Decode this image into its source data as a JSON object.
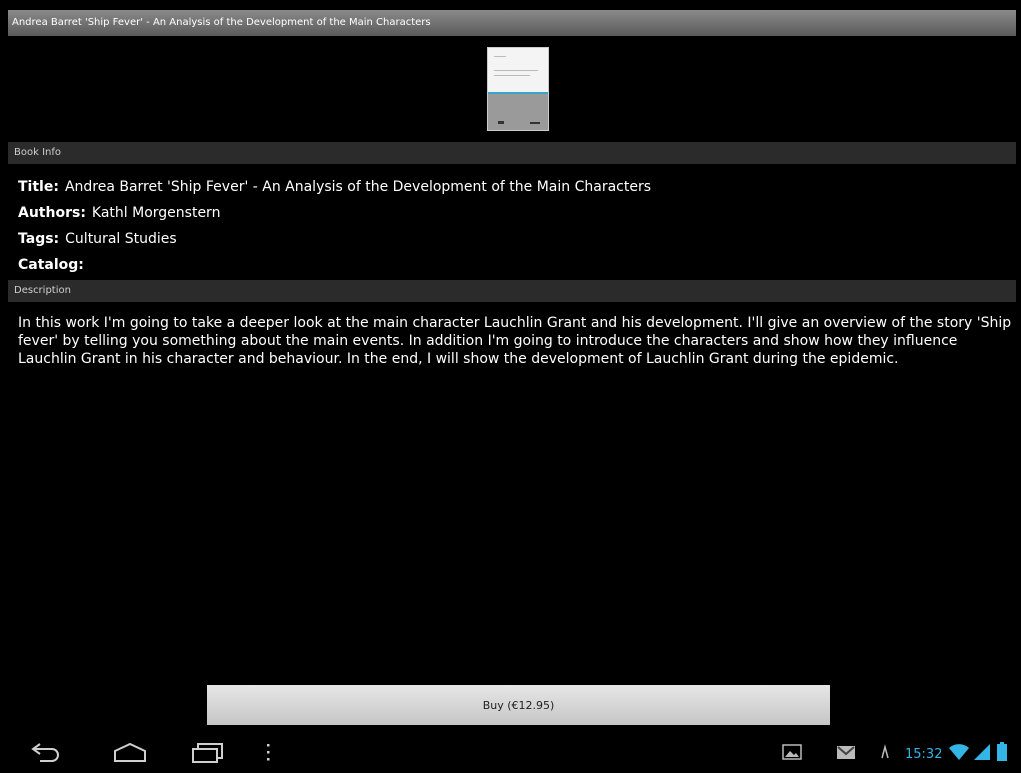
{
  "window": {
    "title": "Andrea Barret 'Ship Fever' - An Analysis of the Development of the Main Characters"
  },
  "book_info": {
    "header": "Book Info",
    "fields": [
      {
        "key": "Title:",
        "value": "Andrea Barret 'Ship Fever' - An Analysis of the Development of the Main Characters"
      },
      {
        "key": "Authors:",
        "value": "Kathl Morgenstern"
      },
      {
        "key": "Tags:",
        "value": "Cultural Studies"
      },
      {
        "key": "Catalog:",
        "value": ""
      }
    ]
  },
  "description": {
    "header": "Description",
    "text": "In this work I'm going to take a deeper look at the main character Lauchlin Grant and his development. I'll give an overview of the story 'Ship fever' by telling you something about the main events. In addition I'm going to introduce the characters and show how they influence Lauchlin Grant in his character and behaviour. In the end, I will show the development of Lauchlin Grant during the epidemic."
  },
  "buy_button": {
    "label": "Buy (€12.95)"
  },
  "navbar": {
    "buttons": [
      "back-icon",
      "home-icon",
      "recent-apps-icon",
      "menu-icon"
    ]
  },
  "status_bar": {
    "time": "15:32",
    "icons": [
      "image-notification-icon",
      "gmail-icon",
      "signal-icon",
      "wifi-icon",
      "cell-signal-icon",
      "battery-icon"
    ],
    "accent": "#33b5e5"
  }
}
